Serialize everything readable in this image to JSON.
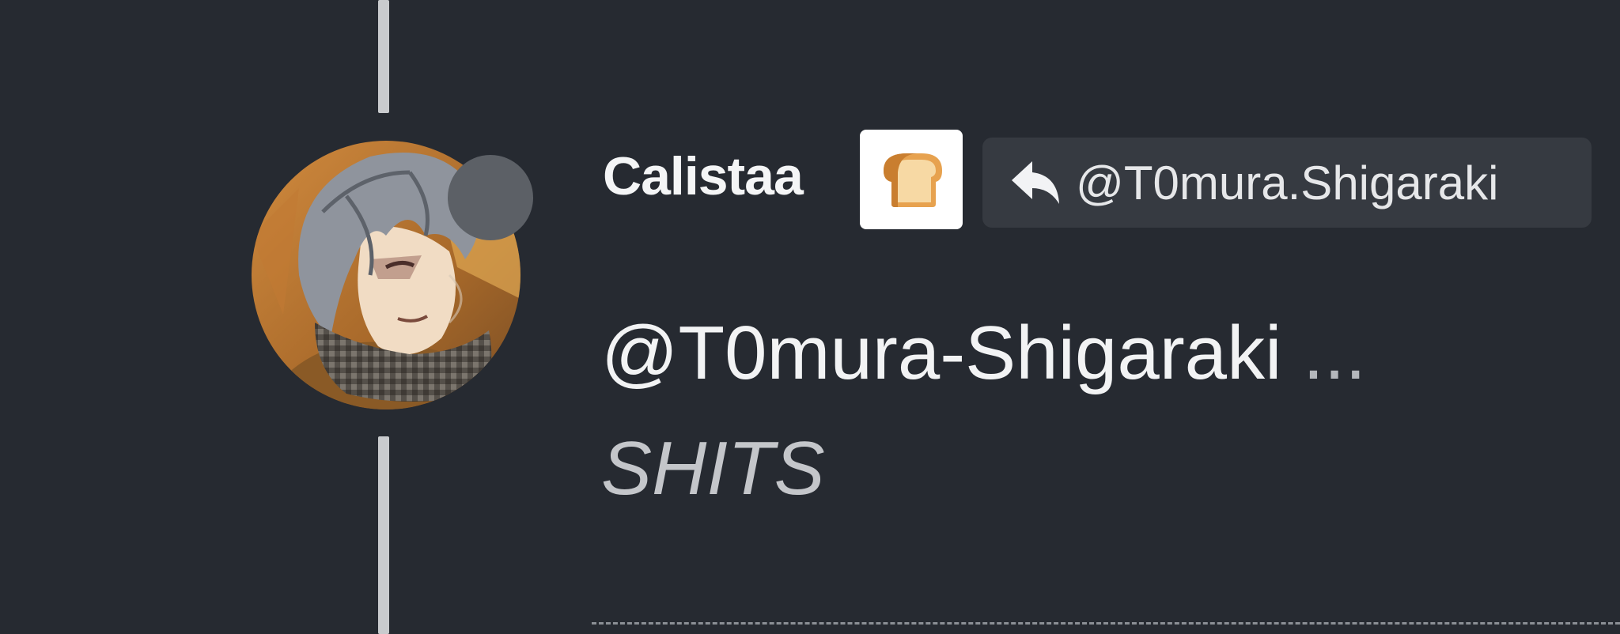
{
  "post": {
    "author_name": "Calistaa",
    "badge_icon": "bread-icon",
    "reply_to": {
      "icon": "reply-arrow-icon",
      "handle": "@T0mura.Shigaraki"
    },
    "body": {
      "mention": "@T0mura-Shigaraki",
      "ellipsis": "...",
      "text": "SHITS"
    },
    "avatar": {
      "status": "offline",
      "status_color": "#5c6066"
    }
  },
  "colors": {
    "background": "#262a31",
    "chip_background": "#363a41",
    "thread_line": "#c9cbce"
  }
}
